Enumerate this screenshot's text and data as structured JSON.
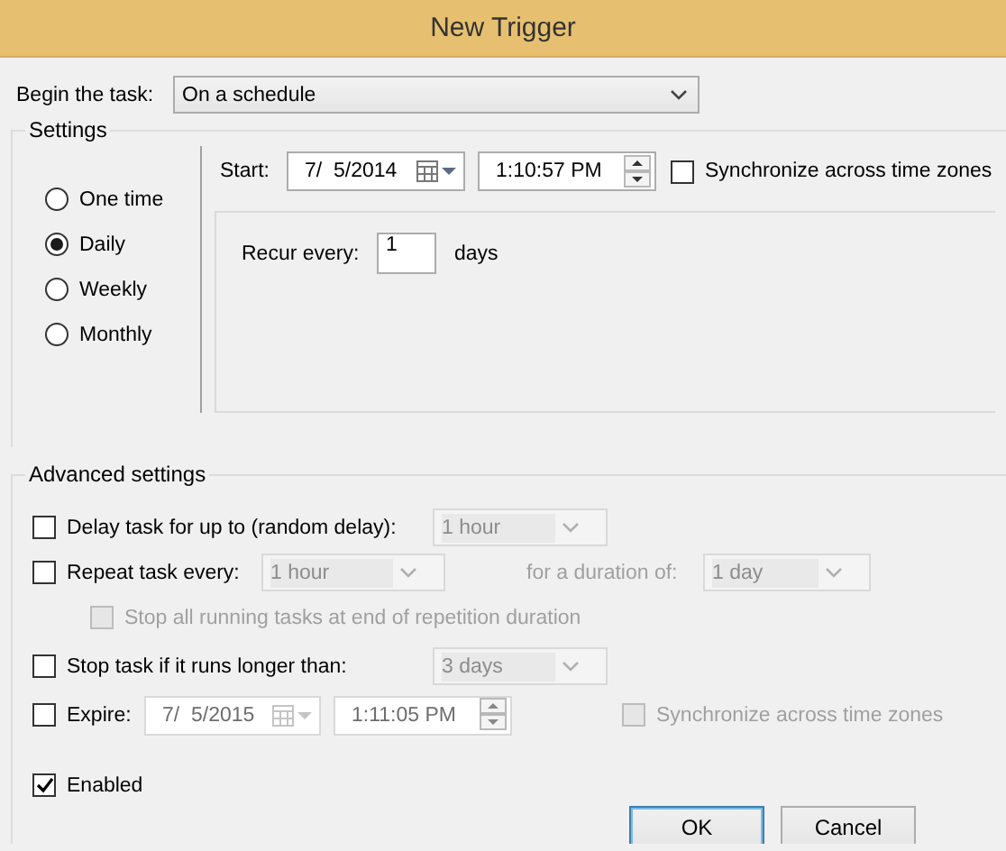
{
  "window": {
    "title": "New Trigger"
  },
  "begin_task": {
    "label": "Begin the task:",
    "value": "On a schedule"
  },
  "settings": {
    "title": "Settings",
    "schedules": [
      {
        "label": "One time",
        "selected": false
      },
      {
        "label": "Daily",
        "selected": true
      },
      {
        "label": "Weekly",
        "selected": false
      },
      {
        "label": "Monthly",
        "selected": false
      }
    ],
    "start": {
      "label": "Start:",
      "date": "7/  5/2014",
      "time": "1:10:57 PM"
    },
    "sync": {
      "label": "Synchronize across time zones",
      "checked": false
    },
    "recur": {
      "label": "Recur every:",
      "value": "1",
      "unit": "days"
    }
  },
  "advanced": {
    "title": "Advanced settings",
    "delay": {
      "label": "Delay task for up to (random delay):",
      "checked": false,
      "value": "1 hour"
    },
    "repeat": {
      "label": "Repeat task every:",
      "checked": false,
      "value": "1 hour",
      "duration_label": "for a duration of:",
      "duration": "1 day"
    },
    "stop_all": {
      "label": "Stop all running tasks at end of repetition duration",
      "checked": false,
      "disabled": true
    },
    "stop_long": {
      "label": "Stop task if it runs longer than:",
      "checked": false,
      "value": "3 days"
    },
    "expire": {
      "label": "Expire:",
      "checked": false,
      "date": "7/  5/2015",
      "time": "1:11:05 PM"
    },
    "expire_sync": {
      "label": "Synchronize across time zones",
      "checked": false,
      "disabled": true
    },
    "enabled": {
      "label": "Enabled",
      "checked": true
    }
  },
  "buttons": [
    {
      "label": "OK",
      "default": true
    },
    {
      "label": "Cancel",
      "default": false
    }
  ]
}
